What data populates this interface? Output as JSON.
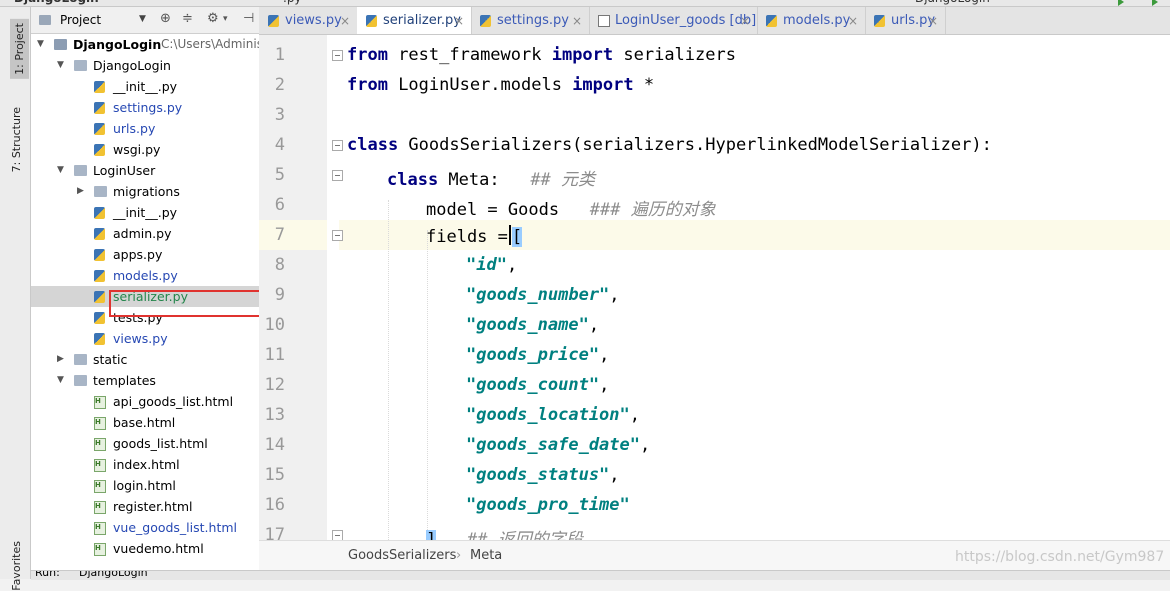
{
  "toolwindows": {
    "project_tab": "1: Project",
    "structure_tab": "7: Structure",
    "favorites_tab": "Favorites"
  },
  "project_panel": {
    "title": "Project"
  },
  "tree": [
    {
      "label": "DjangoLogin",
      "path": "C:\\Users\\Adminis",
      "kind": "project",
      "expanded": true
    },
    {
      "label": "DjangoLogin",
      "kind": "dir",
      "expanded": true
    },
    {
      "label": "__init__.py",
      "kind": "py"
    },
    {
      "label": "settings.py",
      "kind": "py",
      "color": "blue"
    },
    {
      "label": "urls.py",
      "kind": "py",
      "color": "blue"
    },
    {
      "label": "wsgi.py",
      "kind": "py"
    },
    {
      "label": "LoginUser",
      "kind": "dir",
      "expanded": true
    },
    {
      "label": "migrations",
      "kind": "dir",
      "expanded": false
    },
    {
      "label": "__init__.py",
      "kind": "py"
    },
    {
      "label": "admin.py",
      "kind": "py"
    },
    {
      "label": "apps.py",
      "kind": "py"
    },
    {
      "label": "models.py",
      "kind": "py",
      "color": "blue"
    },
    {
      "label": "serializer.py",
      "kind": "py",
      "color": "green",
      "selected": true
    },
    {
      "label": "tests.py",
      "kind": "py"
    },
    {
      "label": "views.py",
      "kind": "py",
      "color": "blue"
    },
    {
      "label": "static",
      "kind": "dir",
      "expanded": false
    },
    {
      "label": "templates",
      "kind": "dir",
      "expanded": true
    },
    {
      "label": "api_goods_list.html",
      "kind": "html"
    },
    {
      "label": "base.html",
      "kind": "html"
    },
    {
      "label": "goods_list.html",
      "kind": "html"
    },
    {
      "label": "index.html",
      "kind": "html"
    },
    {
      "label": "login.html",
      "kind": "html"
    },
    {
      "label": "register.html",
      "kind": "html"
    },
    {
      "label": "vue_goods_list.html",
      "kind": "html",
      "color": "blue"
    },
    {
      "label": "vuedemo.html",
      "kind": "html"
    }
  ],
  "tabs": [
    {
      "label": "views.py",
      "icon": "python-file-icon"
    },
    {
      "label": "serializer.py",
      "icon": "python-file-icon",
      "active": true
    },
    {
      "label": "settings.py",
      "icon": "python-file-icon"
    },
    {
      "label": "LoginUser_goods [db]",
      "icon": "database-table-icon"
    },
    {
      "label": "models.py",
      "icon": "python-file-icon"
    },
    {
      "label": "urls.py",
      "icon": "python-file-icon"
    }
  ],
  "line_numbers": [
    "1",
    "2",
    "3",
    "4",
    "5",
    "6",
    "7",
    "8",
    "9",
    "10",
    "11",
    "12",
    "13",
    "14",
    "15",
    "16",
    "17"
  ],
  "code": {
    "l1": {
      "kw1": "from",
      "mod": " rest_framework ",
      "kw2": "import",
      "rest": " serializers"
    },
    "l2": {
      "kw1": "from",
      "mod": " LoginUser.models ",
      "kw2": "import",
      "rest": " *"
    },
    "l4": {
      "kw": "class",
      "rest": " GoodsSerializers(serializers.HyperlinkedModelSerializer):"
    },
    "l5": {
      "kw": "class",
      "rest": " Meta:   ",
      "comment": "## 元类"
    },
    "l6": {
      "rest": "model = Goods   ",
      "comment": "### 遍历的对象"
    },
    "l7": {
      "rest": "fields =",
      "bracket": "["
    },
    "fields": [
      "\"id\"",
      "\"goods_number\"",
      "\"goods_name\"",
      "\"goods_price\"",
      "\"goods_count\"",
      "\"goods_location\"",
      "\"goods_safe_date\"",
      "\"goods_status\"",
      "\"goods_pro_time\""
    ],
    "l17": {
      "bracket": "]",
      "comment": "## 返回的字段"
    }
  },
  "breadcrumb": {
    "first": "GoodsSerializers",
    "sep": "›",
    "second": "Meta"
  },
  "status": {
    "run_label": "Run:",
    "run_target": "DjangoLogin"
  },
  "watermark": "https://blog.csdn.net/Gym987"
}
